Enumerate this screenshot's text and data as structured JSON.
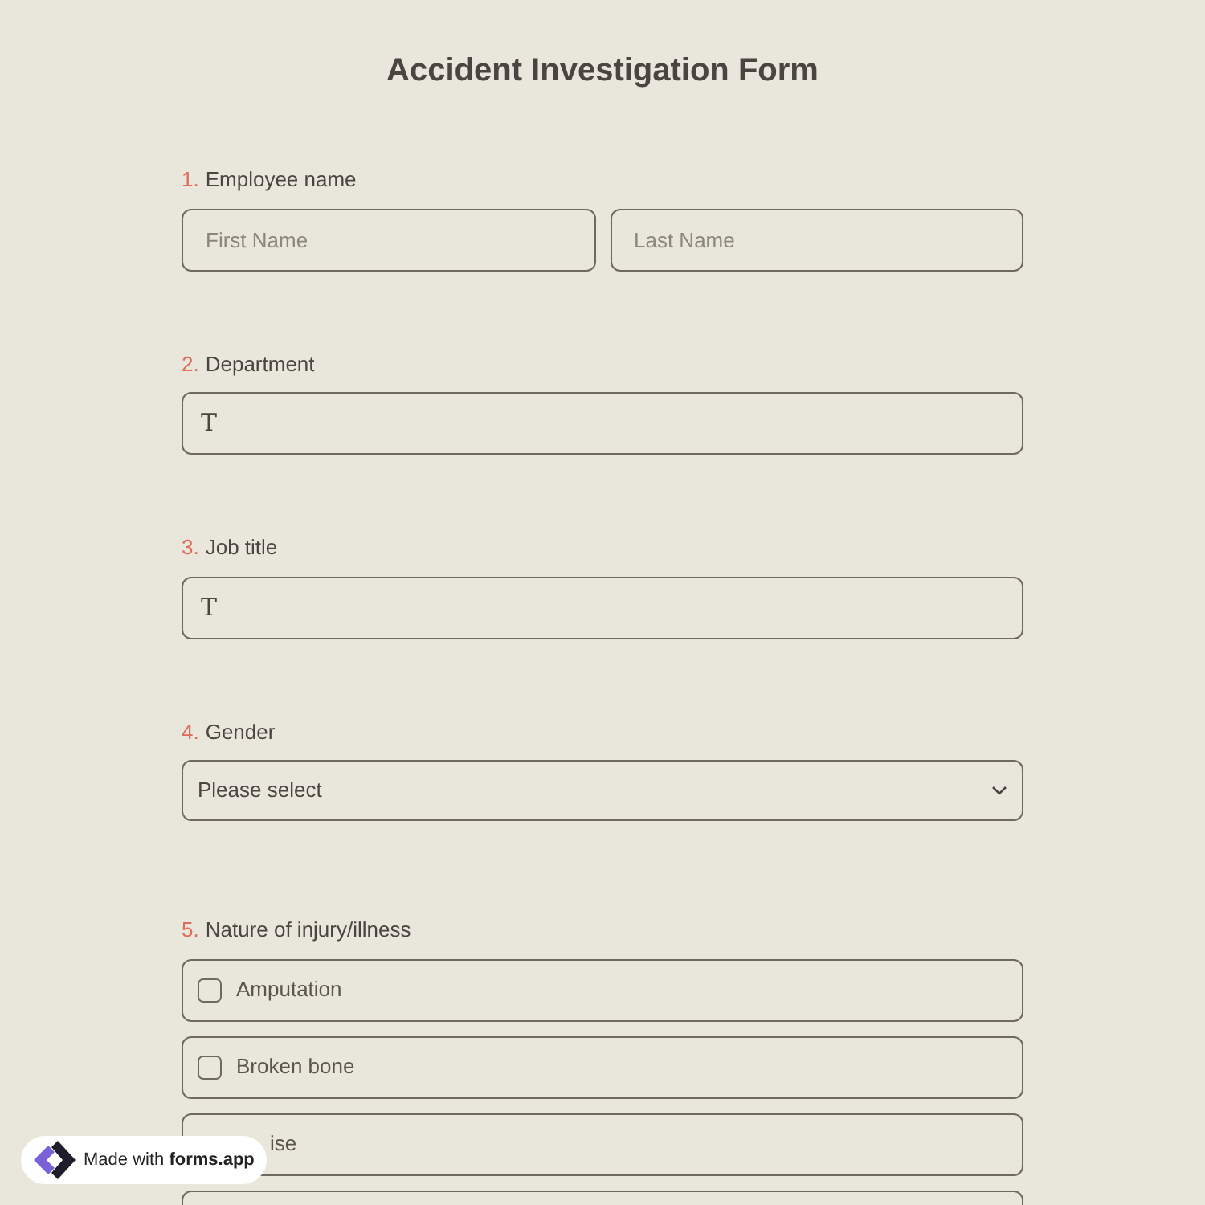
{
  "title": "Accident Investigation Form",
  "questions": [
    {
      "number": "1.",
      "label": "Employee name",
      "kind": "name",
      "placeholders": [
        "First Name",
        "Last Name"
      ]
    },
    {
      "number": "2.",
      "label": "Department",
      "kind": "text",
      "icon_text": "T"
    },
    {
      "number": "3.",
      "label": "Job title",
      "kind": "text",
      "icon_text": "T"
    },
    {
      "number": "4.",
      "label": "Gender",
      "kind": "select",
      "placeholder": "Please select"
    },
    {
      "number": "5.",
      "label": "Nature of injury/illness",
      "kind": "checkboxes",
      "options": [
        {
          "label": "Amputation",
          "checked": false,
          "kind": "full"
        },
        {
          "label": "Broken bone",
          "checked": false,
          "kind": "full"
        },
        {
          "label": "ise",
          "kind": "covered"
        },
        {
          "kind": "cut"
        }
      ]
    }
  ],
  "badge": {
    "prefix": "Made with",
    "brand": "forms.app"
  }
}
